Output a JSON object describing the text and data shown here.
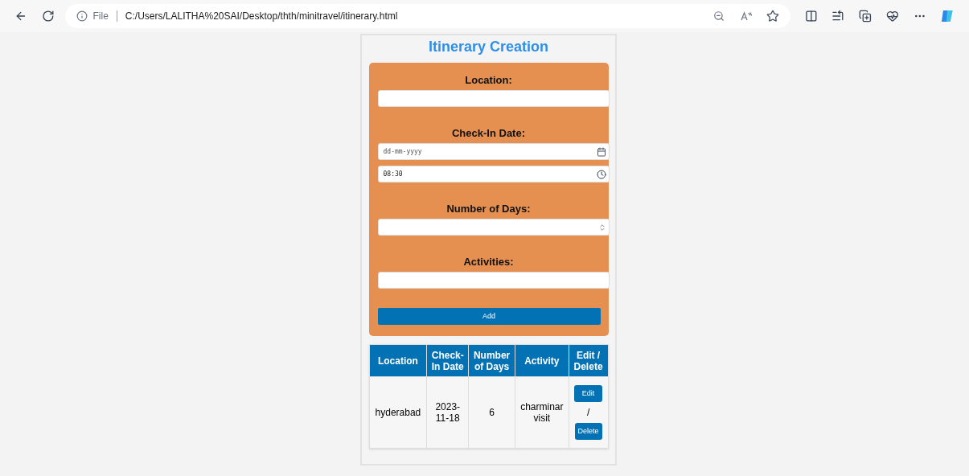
{
  "browser": {
    "scheme_label": "File",
    "url": "C:/Users/LALITHA%20SAI/Desktop/thth/minitravel/itinerary.html"
  },
  "page": {
    "title": "Itinerary Creation",
    "form": {
      "groups": [
        {
          "label": "Location:",
          "fields": [
            {
              "kind": "text"
            }
          ]
        },
        {
          "label": "Check-In Date:",
          "fields": [
            {
              "kind": "date",
              "placeholder": "dd-mm-yyyy"
            },
            {
              "kind": "time",
              "value": "08:30"
            }
          ]
        },
        {
          "label": "Number of Days:",
          "fields": [
            {
              "kind": "number"
            }
          ]
        },
        {
          "label": "Activities:",
          "fields": [
            {
              "kind": "text"
            }
          ]
        }
      ],
      "submit": "Add"
    },
    "table": {
      "columns": [
        "Location",
        "Check-In Date",
        "Number of Days",
        "Activity",
        "Edit / Delete"
      ],
      "rows": [
        {
          "location": "hyderabad",
          "check_in_date": "2023-11-18",
          "days": "6",
          "activity": "charminar visit",
          "edit": "Edit",
          "separator": "/",
          "delete": "Delete"
        }
      ]
    }
  }
}
